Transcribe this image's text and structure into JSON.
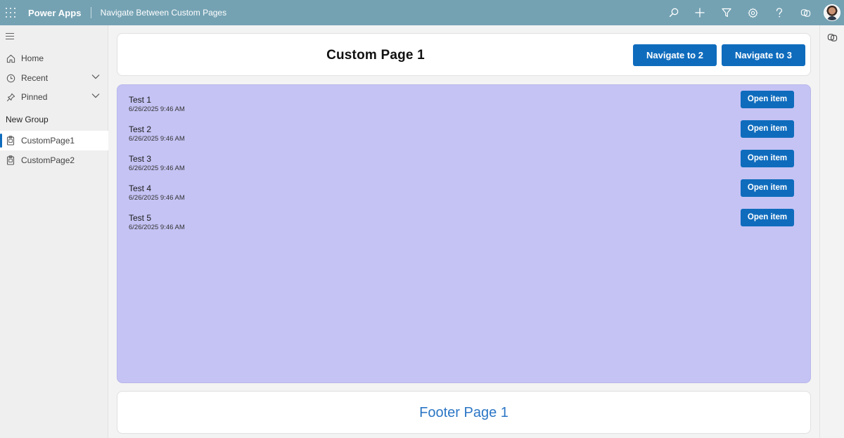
{
  "topbar": {
    "app_name": "Power Apps",
    "app_title": "Navigate Between Custom Pages",
    "icons": [
      "search-icon",
      "add-icon",
      "filter-icon",
      "settings-icon",
      "help-icon",
      "copilot-icon",
      "avatar"
    ]
  },
  "leftnav": {
    "items": [
      {
        "label": "Home",
        "icon": "home-icon"
      },
      {
        "label": "Recent",
        "icon": "clock-icon"
      },
      {
        "label": "Pinned",
        "icon": "pin-icon"
      }
    ],
    "group_label": "New Group",
    "pages": [
      {
        "label": "CustomPage1",
        "icon": "page-icon",
        "active": true
      },
      {
        "label": "CustomPage2",
        "icon": "page-icon",
        "active": false
      }
    ]
  },
  "header": {
    "title": "Custom Page 1",
    "navigate2_label": "Navigate to 2",
    "navigate3_label": "Navigate to 3"
  },
  "list": {
    "items": [
      {
        "title": "Test 1",
        "date": "6/26/2025 9:46 AM",
        "button": "Open item"
      },
      {
        "title": "Test 2",
        "date": "6/26/2025 9:46 AM",
        "button": "Open item"
      },
      {
        "title": "Test 3",
        "date": "6/26/2025 9:46 AM",
        "button": "Open item"
      },
      {
        "title": "Test 4",
        "date": "6/26/2025 9:46 AM",
        "button": "Open item"
      },
      {
        "title": "Test 5",
        "date": "6/26/2025 9:46 AM",
        "button": "Open item"
      }
    ]
  },
  "footer": {
    "text": "Footer Page 1"
  },
  "colors": {
    "topbar": "#74a2b3",
    "accent": "#0f6cbd",
    "list_background": "#c5c3f4",
    "footer_text": "#2b76c5"
  }
}
